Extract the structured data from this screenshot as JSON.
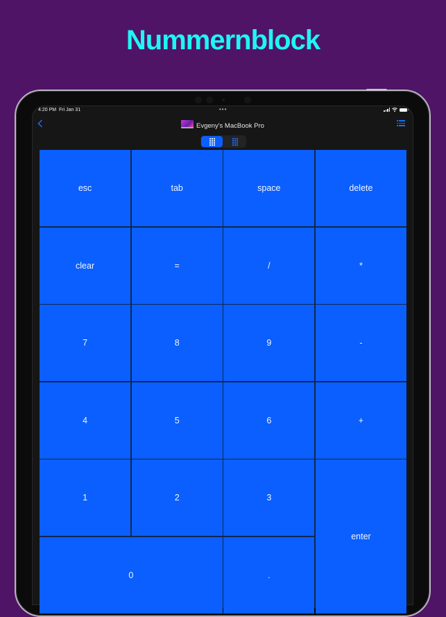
{
  "promo": {
    "title": "Nummernblock"
  },
  "colors": {
    "background": "#4f1466",
    "title": "#1ff5f5",
    "key": "#0a5ffe",
    "accent": "#1f6cf5"
  },
  "status_bar": {
    "time": "4:20 PM",
    "date": "Fri Jan 31",
    "multitask": "•••"
  },
  "nav": {
    "back_icon": "chevron-left-icon",
    "device_icon": "macbook-icon",
    "title": "Evgeny's MacBook Pro",
    "menu_icon": "list-icon"
  },
  "mode_switch": {
    "options": [
      {
        "name": "numpad",
        "icon": "numpad-grid-icon",
        "selected": true
      },
      {
        "name": "other-layout",
        "icon": "layout-grid-icon",
        "selected": false
      }
    ]
  },
  "keys": {
    "esc": "esc",
    "tab": "tab",
    "space": "space",
    "delete": "delete",
    "clear": "clear",
    "equals": "=",
    "divide": "/",
    "multiply": "*",
    "seven": "7",
    "eight": "8",
    "nine": "9",
    "minus": "-",
    "four": "4",
    "five": "5",
    "six": "6",
    "plus": "+",
    "one": "1",
    "two": "2",
    "three": "3",
    "enter": "enter",
    "zero": "0",
    "dot": "."
  }
}
